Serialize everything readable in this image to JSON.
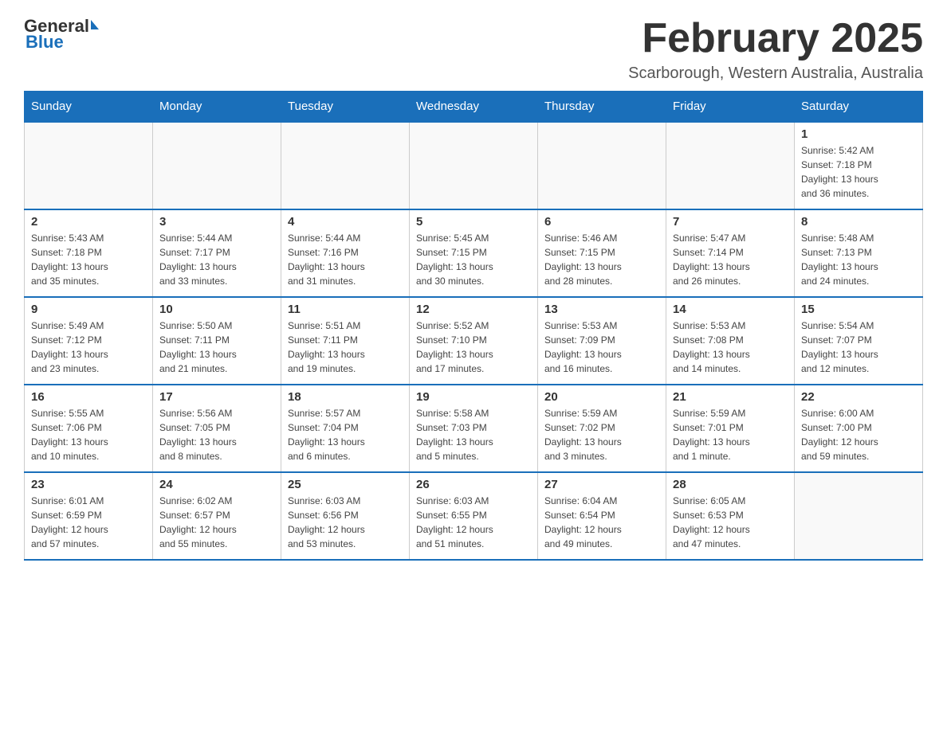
{
  "header": {
    "logo_general": "General",
    "logo_blue": "Blue",
    "month_title": "February 2025",
    "location": "Scarborough, Western Australia, Australia"
  },
  "days_of_week": [
    "Sunday",
    "Monday",
    "Tuesday",
    "Wednesday",
    "Thursday",
    "Friday",
    "Saturday"
  ],
  "weeks": [
    {
      "days": [
        {
          "num": "",
          "info": ""
        },
        {
          "num": "",
          "info": ""
        },
        {
          "num": "",
          "info": ""
        },
        {
          "num": "",
          "info": ""
        },
        {
          "num": "",
          "info": ""
        },
        {
          "num": "",
          "info": ""
        },
        {
          "num": "1",
          "info": "Sunrise: 5:42 AM\nSunset: 7:18 PM\nDaylight: 13 hours\nand 36 minutes."
        }
      ]
    },
    {
      "days": [
        {
          "num": "2",
          "info": "Sunrise: 5:43 AM\nSunset: 7:18 PM\nDaylight: 13 hours\nand 35 minutes."
        },
        {
          "num": "3",
          "info": "Sunrise: 5:44 AM\nSunset: 7:17 PM\nDaylight: 13 hours\nand 33 minutes."
        },
        {
          "num": "4",
          "info": "Sunrise: 5:44 AM\nSunset: 7:16 PM\nDaylight: 13 hours\nand 31 minutes."
        },
        {
          "num": "5",
          "info": "Sunrise: 5:45 AM\nSunset: 7:15 PM\nDaylight: 13 hours\nand 30 minutes."
        },
        {
          "num": "6",
          "info": "Sunrise: 5:46 AM\nSunset: 7:15 PM\nDaylight: 13 hours\nand 28 minutes."
        },
        {
          "num": "7",
          "info": "Sunrise: 5:47 AM\nSunset: 7:14 PM\nDaylight: 13 hours\nand 26 minutes."
        },
        {
          "num": "8",
          "info": "Sunrise: 5:48 AM\nSunset: 7:13 PM\nDaylight: 13 hours\nand 24 minutes."
        }
      ]
    },
    {
      "days": [
        {
          "num": "9",
          "info": "Sunrise: 5:49 AM\nSunset: 7:12 PM\nDaylight: 13 hours\nand 23 minutes."
        },
        {
          "num": "10",
          "info": "Sunrise: 5:50 AM\nSunset: 7:11 PM\nDaylight: 13 hours\nand 21 minutes."
        },
        {
          "num": "11",
          "info": "Sunrise: 5:51 AM\nSunset: 7:11 PM\nDaylight: 13 hours\nand 19 minutes."
        },
        {
          "num": "12",
          "info": "Sunrise: 5:52 AM\nSunset: 7:10 PM\nDaylight: 13 hours\nand 17 minutes."
        },
        {
          "num": "13",
          "info": "Sunrise: 5:53 AM\nSunset: 7:09 PM\nDaylight: 13 hours\nand 16 minutes."
        },
        {
          "num": "14",
          "info": "Sunrise: 5:53 AM\nSunset: 7:08 PM\nDaylight: 13 hours\nand 14 minutes."
        },
        {
          "num": "15",
          "info": "Sunrise: 5:54 AM\nSunset: 7:07 PM\nDaylight: 13 hours\nand 12 minutes."
        }
      ]
    },
    {
      "days": [
        {
          "num": "16",
          "info": "Sunrise: 5:55 AM\nSunset: 7:06 PM\nDaylight: 13 hours\nand 10 minutes."
        },
        {
          "num": "17",
          "info": "Sunrise: 5:56 AM\nSunset: 7:05 PM\nDaylight: 13 hours\nand 8 minutes."
        },
        {
          "num": "18",
          "info": "Sunrise: 5:57 AM\nSunset: 7:04 PM\nDaylight: 13 hours\nand 6 minutes."
        },
        {
          "num": "19",
          "info": "Sunrise: 5:58 AM\nSunset: 7:03 PM\nDaylight: 13 hours\nand 5 minutes."
        },
        {
          "num": "20",
          "info": "Sunrise: 5:59 AM\nSunset: 7:02 PM\nDaylight: 13 hours\nand 3 minutes."
        },
        {
          "num": "21",
          "info": "Sunrise: 5:59 AM\nSunset: 7:01 PM\nDaylight: 13 hours\nand 1 minute."
        },
        {
          "num": "22",
          "info": "Sunrise: 6:00 AM\nSunset: 7:00 PM\nDaylight: 12 hours\nand 59 minutes."
        }
      ]
    },
    {
      "days": [
        {
          "num": "23",
          "info": "Sunrise: 6:01 AM\nSunset: 6:59 PM\nDaylight: 12 hours\nand 57 minutes."
        },
        {
          "num": "24",
          "info": "Sunrise: 6:02 AM\nSunset: 6:57 PM\nDaylight: 12 hours\nand 55 minutes."
        },
        {
          "num": "25",
          "info": "Sunrise: 6:03 AM\nSunset: 6:56 PM\nDaylight: 12 hours\nand 53 minutes."
        },
        {
          "num": "26",
          "info": "Sunrise: 6:03 AM\nSunset: 6:55 PM\nDaylight: 12 hours\nand 51 minutes."
        },
        {
          "num": "27",
          "info": "Sunrise: 6:04 AM\nSunset: 6:54 PM\nDaylight: 12 hours\nand 49 minutes."
        },
        {
          "num": "28",
          "info": "Sunrise: 6:05 AM\nSunset: 6:53 PM\nDaylight: 12 hours\nand 47 minutes."
        },
        {
          "num": "",
          "info": ""
        }
      ]
    }
  ]
}
